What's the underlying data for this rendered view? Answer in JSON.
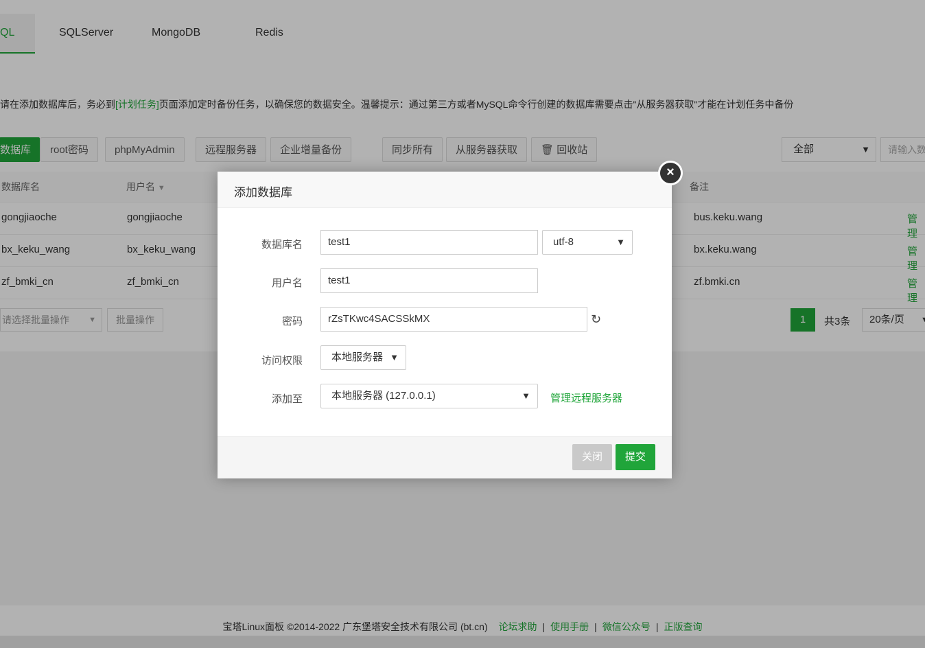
{
  "tabs": [
    "QL",
    "SQLServer",
    "MongoDB",
    "Redis"
  ],
  "notice": {
    "before": "请在添加数据库后，务必到",
    "link": "[计划任务]",
    "after": "页面添加定时备份任务，以确保您的数据安全。温馨提示：通过第三方或者MySQL命令行创建的数据库需要点击\"从服务器获取\"才能在计划任务中备份"
  },
  "toolbar": {
    "add": "数据库",
    "root_password": "root密码",
    "phpmyadmin": "phpMyAdmin",
    "remote_server": "远程服务器",
    "enterprise_backup": "企业增量备份",
    "sync_all": "同步所有",
    "fetch_from_server": "从服务器获取",
    "recycle_bin": "回收站",
    "filter_value": "全部",
    "search_placeholder": "请输入数"
  },
  "table": {
    "headers": [
      "数据库名",
      "用户名",
      "备注"
    ],
    "rows": [
      {
        "db": "gongjiaoche",
        "user": "gongjiaoche",
        "note": "bus.keku.wang",
        "action": "管理"
      },
      {
        "db": "bx_keku_wang",
        "user": "bx_keku_wang",
        "note": "bx.keku.wang",
        "action": "管理"
      },
      {
        "db": "zf_bmki_cn",
        "user": "zf_bmki_cn",
        "note": "zf.bmki.cn",
        "action": "管理"
      }
    ]
  },
  "batch": {
    "select_placeholder": "请选择批量操作",
    "button": "批量操作"
  },
  "pager": {
    "current": "1",
    "total": "共3条",
    "per_page": "20条/页"
  },
  "modal": {
    "title": "添加数据库",
    "db_name_label": "数据库名",
    "db_name_value": "test1",
    "charset_value": "utf-8",
    "user_label": "用户名",
    "user_value": "test1",
    "password_label": "密码",
    "password_value": "rZsTKwc4SACSSkMX",
    "access_label": "访问权限",
    "access_value": "本地服务器",
    "add_to_label": "添加至",
    "add_to_value": "本地服务器 (127.0.0.1)",
    "manage_remote_link": "管理远程服务器",
    "cancel_button": "关闭",
    "submit_button": "提交"
  },
  "footer": {
    "copyright": "宝塔Linux面板 ©2014-2022 广东堡塔安全技术有限公司 (bt.cn)",
    "links": [
      "论坛求助",
      "使用手册",
      "微信公众号",
      "正版查询"
    ]
  },
  "colors": {
    "accent": "#20a53a"
  }
}
